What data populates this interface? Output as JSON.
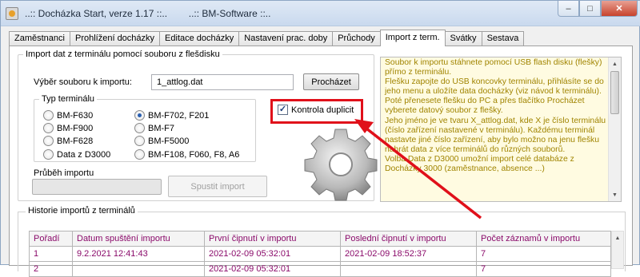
{
  "window": {
    "title": "..:: Docházka Start, verze 1.17 ::..        ..:: BM-Software ::..",
    "controls": {
      "minimize": "–",
      "maximize": "□",
      "close": "✕"
    }
  },
  "tabs": [
    {
      "label": "Zaměstnanci"
    },
    {
      "label": "Prohlížení docházky"
    },
    {
      "label": "Editace docházky"
    },
    {
      "label": "Nastavení prac. doby"
    },
    {
      "label": "Průchody"
    },
    {
      "label": "Import z term.",
      "active": true
    },
    {
      "label": "Svátky"
    },
    {
      "label": "Sestava"
    }
  ],
  "import_group": {
    "legend": "Import dat z terminálu pomocí souboru z flešdisku",
    "file_label": "Výběr souboru k importu:",
    "file_value": "1_attlog.dat",
    "browse_button": "Procházet",
    "duplicate_check": {
      "label": "Kontrola duplicit",
      "checked": true
    },
    "progress_label": "Průběh importu",
    "progress_value": 0,
    "start_button": "Spustit import"
  },
  "terminal_type": {
    "legend": "Typ terminálu",
    "options_left": [
      "BM-F630",
      "BM-F900",
      "BM-F628",
      "Data z D3000"
    ],
    "options_right": [
      "BM-F702, F201",
      "BM-F7",
      "BM-F5000",
      "BM-F108, F060, F8, A6"
    ],
    "selected": "BM-F702, F201"
  },
  "info_text": "Soubor k importu stáhnete pomocí USB flash disku (flešky) přímo z terminálu.\nFlešku zapojte do USB koncovky terminálu, přihlásíte se do jeho menu a uložíte data docházky (viz návod k terminálu).\nPoté přenesete flešku do PC a přes tlačítko Procházet vyberete datový soubor z flešky.\nJeho jméno je ve tvaru X_attlog.dat, kde X je číslo terminálu (číslo zařízení nastavené v terminálu). Každému terminál nastavte jiné číslo zařízení, aby bylo možno na jenu flešku nahrát data z více terminálů do různých souborů.\nVolba Data z D3000 umožní import celé databáze z Docházky 3000 (zaměstnance, absence ...)",
  "history": {
    "legend": "Historie importů z terminálů",
    "columns": [
      "Pořadí",
      "Datum spuštění importu",
      "První čipnutí v importu",
      "Poslední čipnutí v importu",
      "Počet záznamů v importu"
    ],
    "rows": [
      [
        "1",
        "9.2.2021 12:41:43",
        "2021-02-09 05:32:01",
        "2021-02-09 18:52:37",
        "7"
      ],
      [
        "2",
        "",
        "2021-02-09 05:32:01",
        "",
        "7"
      ]
    ]
  },
  "colors": {
    "highlight": "#e0101a",
    "info_text": "#a08400",
    "grid_text": "#8a0a6a"
  }
}
